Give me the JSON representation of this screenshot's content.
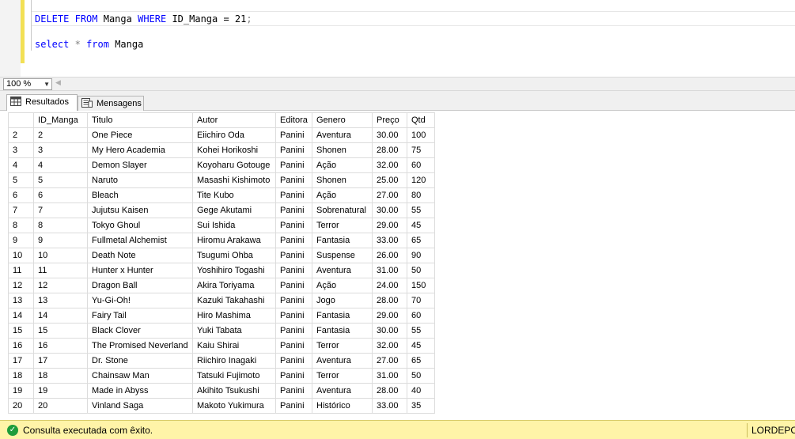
{
  "editor": {
    "line1": {
      "kw_delete": "DELETE",
      "kw_from": "FROM",
      "table": "Manga",
      "kw_where": "WHERE",
      "condition": "ID_Manga = 21",
      "semicolon": ";"
    },
    "line2": {
      "kw_select": "select",
      "star": "*",
      "kw_from": "from",
      "table": "Manga"
    }
  },
  "zoom": {
    "value": "100 %"
  },
  "tabs": [
    {
      "label": "Resultados",
      "icon": "grid-icon",
      "active": true
    },
    {
      "label": "Mensagens",
      "icon": "messages-icon",
      "active": false
    }
  ],
  "grid": {
    "columns": [
      "",
      "ID_Manga",
      "Titulo",
      "Autor",
      "Editora",
      "Genero",
      "Preço",
      "Qtd"
    ],
    "rows": [
      [
        "2",
        "2",
        "One Piece",
        "Eiichiro Oda",
        "Panini",
        "Aventura",
        "30.00",
        "100"
      ],
      [
        "3",
        "3",
        "My Hero Academia",
        "Kohei Horikoshi",
        "Panini",
        "Shonen",
        "28.00",
        "75"
      ],
      [
        "4",
        "4",
        "Demon Slayer",
        "Koyoharu Gotouge",
        "Panini",
        "Ação",
        "32.00",
        "60"
      ],
      [
        "5",
        "5",
        "Naruto",
        "Masashi Kishimoto",
        "Panini",
        "Shonen",
        "25.00",
        "120"
      ],
      [
        "6",
        "6",
        "Bleach",
        "Tite Kubo",
        "Panini",
        "Ação",
        "27.00",
        "80"
      ],
      [
        "7",
        "7",
        "Jujutsu Kaisen",
        "Gege Akutami",
        "Panini",
        "Sobrenatural",
        "30.00",
        "55"
      ],
      [
        "8",
        "8",
        "Tokyo Ghoul",
        "Sui Ishida",
        "Panini",
        "Terror",
        "29.00",
        "45"
      ],
      [
        "9",
        "9",
        "Fullmetal Alchemist",
        "Hiromu Arakawa",
        "Panini",
        "Fantasia",
        "33.00",
        "65"
      ],
      [
        "10",
        "10",
        "Death Note",
        "Tsugumi Ohba",
        "Panini",
        "Suspense",
        "26.00",
        "90"
      ],
      [
        "11",
        "11",
        "Hunter x Hunter",
        "Yoshihiro Togashi",
        "Panini",
        "Aventura",
        "31.00",
        "50"
      ],
      [
        "12",
        "12",
        "Dragon Ball",
        "Akira Toriyama",
        "Panini",
        "Ação",
        "24.00",
        "150"
      ],
      [
        "13",
        "13",
        "Yu-Gi-Oh!",
        "Kazuki Takahashi",
        "Panini",
        "Jogo",
        "28.00",
        "70"
      ],
      [
        "14",
        "14",
        "Fairy Tail",
        "Hiro Mashima",
        "Panini",
        "Fantasia",
        "29.00",
        "60"
      ],
      [
        "15",
        "15",
        "Black Clover",
        "Yuki Tabata",
        "Panini",
        "Fantasia",
        "30.00",
        "55"
      ],
      [
        "16",
        "16",
        "The Promised Neverland",
        "Kaiu Shirai",
        "Panini",
        "Terror",
        "32.00",
        "45"
      ],
      [
        "17",
        "17",
        "Dr. Stone",
        "Riichiro Inagaki",
        "Panini",
        "Aventura",
        "27.00",
        "65"
      ],
      [
        "18",
        "18",
        "Chainsaw Man",
        "Tatsuki Fujimoto",
        "Panini",
        "Terror",
        "31.00",
        "50"
      ],
      [
        "19",
        "19",
        "Made in Abyss",
        "Akihito Tsukushi",
        "Panini",
        "Aventura",
        "28.00",
        "40"
      ],
      [
        "20",
        "20",
        "Vinland Saga",
        "Makoto Yukimura",
        "Panini",
        "Histórico",
        "33.00",
        "35"
      ]
    ]
  },
  "status": {
    "icon": "check-circle-icon",
    "message": "Consulta executada com êxito.",
    "server": "LORDEPC ("
  },
  "colors": {
    "keyword": "#0000ff",
    "status_bg": "#fff4a8",
    "success": "#1f9d3a"
  }
}
